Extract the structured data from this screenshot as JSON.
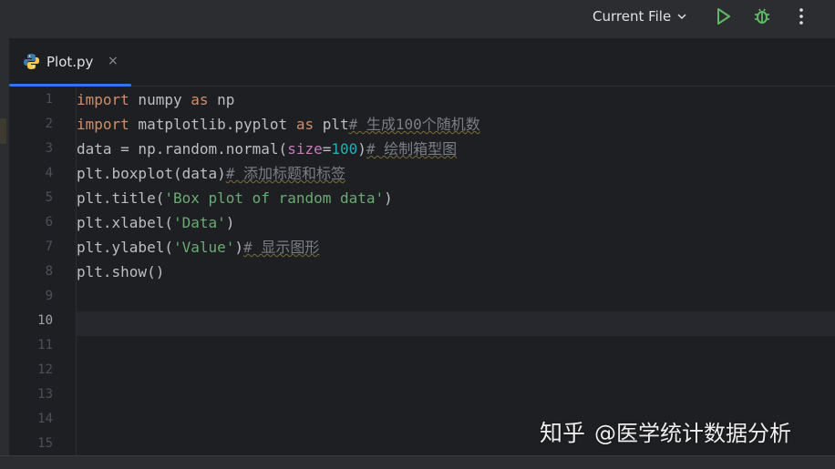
{
  "toolbar": {
    "run_config_label": "Current File",
    "icons": [
      "chevron-down-icon",
      "run-icon",
      "debug-icon",
      "more-vertical-icon"
    ],
    "colors": {
      "run": "#5fb865",
      "debug": "#5fb865"
    }
  },
  "tab": {
    "file_name": "Plot.py",
    "close_symbol": "×",
    "icon": "python-file-icon",
    "accent": "#3574f0"
  },
  "editor": {
    "line_numbers": [
      "1",
      "2",
      "3",
      "4",
      "5",
      "6",
      "7",
      "8",
      "9",
      "10",
      "11",
      "12",
      "13",
      "14",
      "15"
    ],
    "current_line": "10",
    "lines": [
      {
        "tokens": [
          [
            "kw",
            "import"
          ],
          [
            "p",
            " numpy "
          ],
          [
            "kw",
            "as"
          ],
          [
            "p",
            " np"
          ]
        ]
      },
      {
        "tokens": [
          [
            "kw",
            "import"
          ],
          [
            "p",
            " matplotlib.pyplot "
          ],
          [
            "kw",
            "as"
          ],
          [
            "p",
            " plt"
          ],
          [
            "cm",
            "# 生成100个随机数"
          ]
        ]
      },
      {
        "tokens": [
          [
            "p",
            "data = np.random.normal("
          ],
          [
            "param",
            "size"
          ],
          [
            "p",
            "="
          ],
          [
            "num",
            "100"
          ],
          [
            "p",
            ")"
          ],
          [
            "cm",
            "# 绘制箱型图"
          ]
        ]
      },
      {
        "tokens": [
          [
            "p",
            "plt.boxplot(data)"
          ],
          [
            "cm",
            "# 添加标题和标签"
          ]
        ]
      },
      {
        "tokens": [
          [
            "p",
            "plt.title("
          ],
          [
            "str",
            "'Box plot of random data'"
          ],
          [
            "p",
            ")"
          ]
        ]
      },
      {
        "tokens": [
          [
            "p",
            "plt.xlabel("
          ],
          [
            "str",
            "'Data'"
          ],
          [
            "p",
            ")"
          ]
        ]
      },
      {
        "tokens": [
          [
            "p",
            "plt.ylabel("
          ],
          [
            "str",
            "'Value'"
          ],
          [
            "p",
            ")"
          ],
          [
            "cm",
            "# 显示图形"
          ]
        ]
      },
      {
        "tokens": [
          [
            "p",
            "plt.show()"
          ]
        ]
      },
      {
        "tokens": []
      },
      {
        "tokens": []
      },
      {
        "tokens": []
      },
      {
        "tokens": []
      },
      {
        "tokens": []
      },
      {
        "tokens": []
      },
      {
        "tokens": []
      }
    ]
  },
  "watermark": {
    "site": "知乎",
    "author": "@医学统计数据分析"
  }
}
